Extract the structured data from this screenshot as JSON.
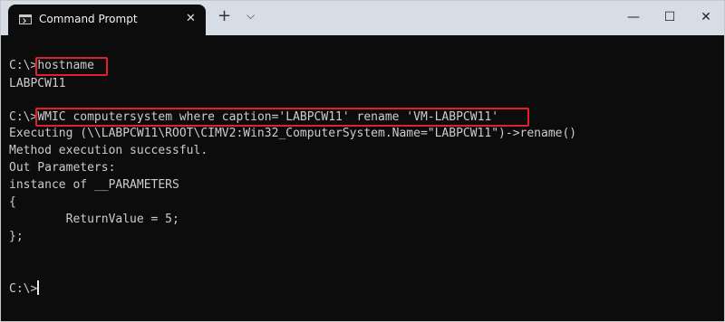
{
  "window": {
    "tab_title": "Command Prompt",
    "tab_close": "✕",
    "new_tab": "+",
    "dropdown": "⌵",
    "minimize": "—",
    "maximize": "☐",
    "close": "✕"
  },
  "terminal": {
    "lines": [
      {
        "prompt": "C:\\>",
        "text": "hostname"
      },
      {
        "text": "LABPCW11"
      },
      {
        "prompt": "C:\\>",
        "text": "WMIC computersystem where caption='LABPCW11' rename 'VM-LABPCW11'"
      },
      {
        "text": "Executing (\\\\LABPCW11\\ROOT\\CIMV2:Win32_ComputerSystem.Name=\"LABPCW11\")->rename()"
      },
      {
        "text": "Method execution successful."
      },
      {
        "text": "Out Parameters:"
      },
      {
        "text": "instance of __PARAMETERS"
      },
      {
        "text": "{"
      },
      {
        "text": "        ReturnValue = 5;"
      },
      {
        "text": "};"
      },
      {
        "prompt": "C:\\>",
        "text": ""
      }
    ]
  },
  "colors": {
    "terminal_bg": "#0c0c0c",
    "terminal_text": "#cccccc",
    "highlight": "#e0202a",
    "titlebar": "#d6dde6"
  }
}
